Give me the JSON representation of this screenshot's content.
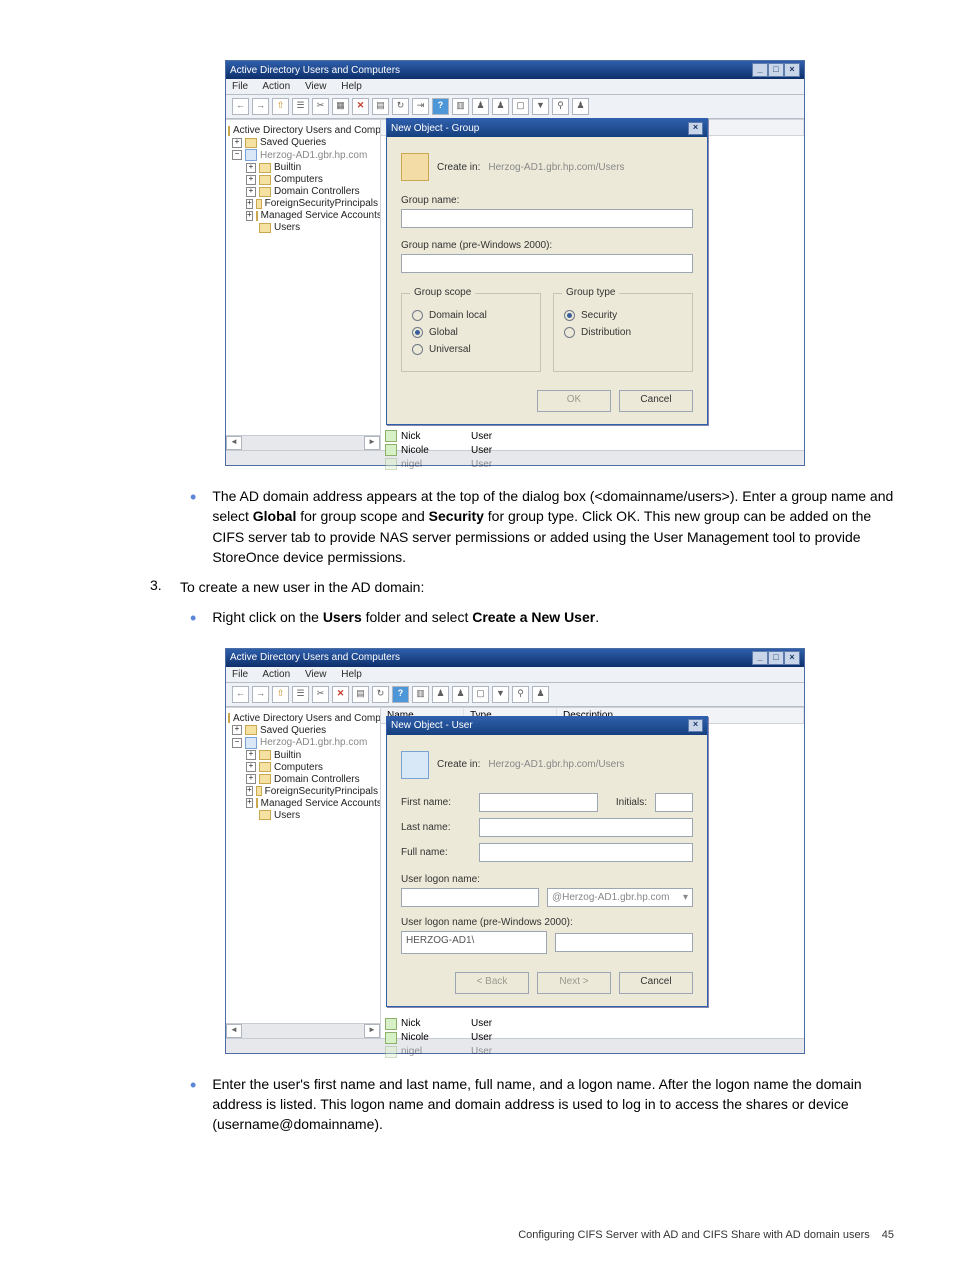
{
  "instructions": {
    "bullet1_a": "The AD domain address appears at the top of the dialog box (<domainname/users>). Enter a group name and select ",
    "bullet1_b": " for group scope and ",
    "bullet1_c": " for group type. Click OK. This new group can be added on the CIFS server tab to provide NAS server permissions or added using the User Management tool to provide StoreOnce device permissions.",
    "bold_global": "Global",
    "bold_security": "Security",
    "step3_num": "3.",
    "step3_text": "To create a new user in the AD domain:",
    "bullet2_a": "Right click on the ",
    "bullet2_b": " folder and select ",
    "bullet2_c": ".",
    "bold_users": "Users",
    "bold_create_new_user": "Create a New User",
    "bullet3": "Enter the user's first name and last name, full name, and a logon name. After the logon name the domain address is listed. This logon name and domain address is used to log in to access the shares or device (username@domainname)."
  },
  "window": {
    "title": "Active Directory Users and Computers",
    "menu": [
      "File",
      "Action",
      "View",
      "Help"
    ],
    "tree": {
      "root": "Active Directory Users and Comput",
      "saved": "Saved Queries",
      "domain": "Herzog-AD1.gbr.hp.com",
      "children": [
        "Builtin",
        "Computers",
        "Domain Controllers",
        "ForeignSecurityPrincipals",
        "Managed Service Accounts",
        "Users"
      ]
    },
    "list": {
      "headers": [
        "Name",
        "Type",
        "Description"
      ],
      "rows": [
        {
          "name": "Nick",
          "type": "User"
        },
        {
          "name": "Nicole",
          "type": "User"
        },
        {
          "name": "nigel",
          "type": "User"
        }
      ]
    }
  },
  "dialog_group": {
    "title": "New Object - Group",
    "create_in_label": "Create in:",
    "create_in_path": "Herzog-AD1.gbr.hp.com/Users",
    "group_name_label": "Group name:",
    "group_name_pre_label": "Group name (pre-Windows 2000):",
    "scope_legend": "Group scope",
    "scope_options": [
      "Domain local",
      "Global",
      "Universal"
    ],
    "type_legend": "Group type",
    "type_options": [
      "Security",
      "Distribution"
    ],
    "ok": "OK",
    "cancel": "Cancel"
  },
  "dialog_user": {
    "title": "New Object - User",
    "create_in_label": "Create in:",
    "create_in_path": "Herzog-AD1.gbr.hp.com/Users",
    "first_name": "First name:",
    "initials": "Initials:",
    "last_name": "Last name:",
    "full_name": "Full name:",
    "logon_label": "User logon name:",
    "logon_domain": "@Herzog-AD1.gbr.hp.com",
    "logon_pre_label": "User logon name (pre-Windows 2000):",
    "logon_pre_value": "HERZOG-AD1\\",
    "back": "< Back",
    "next": "Next >",
    "cancel": "Cancel"
  },
  "footer": {
    "text": "Configuring CIFS Server with AD and CIFS Share with AD domain users",
    "page": "45"
  }
}
